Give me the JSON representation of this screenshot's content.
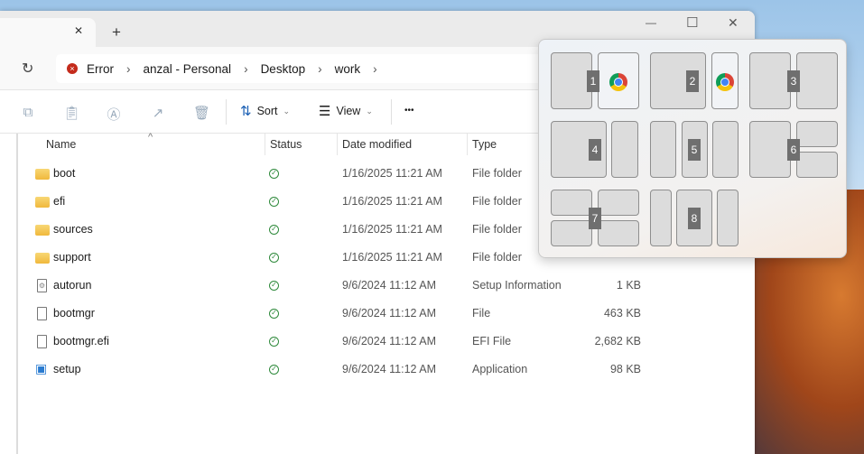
{
  "window": {
    "tab_close": "✕",
    "new_tab": "+",
    "minimize": "—",
    "maximize": "☐",
    "close": "✕"
  },
  "address": {
    "refresh": "↻",
    "crumbs": [
      "Error",
      "anzal - Personal",
      "Desktop",
      "work"
    ],
    "sep": "›"
  },
  "toolbar": {
    "sort": "Sort",
    "view": "View",
    "more": "•••",
    "chev": "⌄"
  },
  "columns": {
    "name": "Name",
    "status": "Status",
    "date": "Date modified",
    "type": "Type",
    "sort_indicator": "^"
  },
  "files": [
    {
      "name": "boot",
      "icon": "folder",
      "date": "1/16/2025 11:21 AM",
      "type": "File folder",
      "size": ""
    },
    {
      "name": "efi",
      "icon": "folder",
      "date": "1/16/2025 11:21 AM",
      "type": "File folder",
      "size": ""
    },
    {
      "name": "sources",
      "icon": "folder",
      "date": "1/16/2025 11:21 AM",
      "type": "File folder",
      "size": ""
    },
    {
      "name": "support",
      "icon": "folder",
      "date": "1/16/2025 11:21 AM",
      "type": "File folder",
      "size": ""
    },
    {
      "name": "autorun",
      "icon": "settings-file",
      "date": "9/6/2024 11:12 AM",
      "type": "Setup Information",
      "size": "1 KB"
    },
    {
      "name": "bootmgr",
      "icon": "file",
      "date": "9/6/2024 11:12 AM",
      "type": "File",
      "size": "463 KB"
    },
    {
      "name": "bootmgr.efi",
      "icon": "file",
      "date": "9/6/2024 11:12 AM",
      "type": "EFI File",
      "size": "2,682 KB"
    },
    {
      "name": "setup",
      "icon": "installer",
      "date": "9/6/2024 11:12 AM",
      "type": "Application",
      "size": "98 KB"
    }
  ],
  "snap_layouts": [
    "1",
    "2",
    "3",
    "4",
    "5",
    "6",
    "7",
    "8"
  ]
}
